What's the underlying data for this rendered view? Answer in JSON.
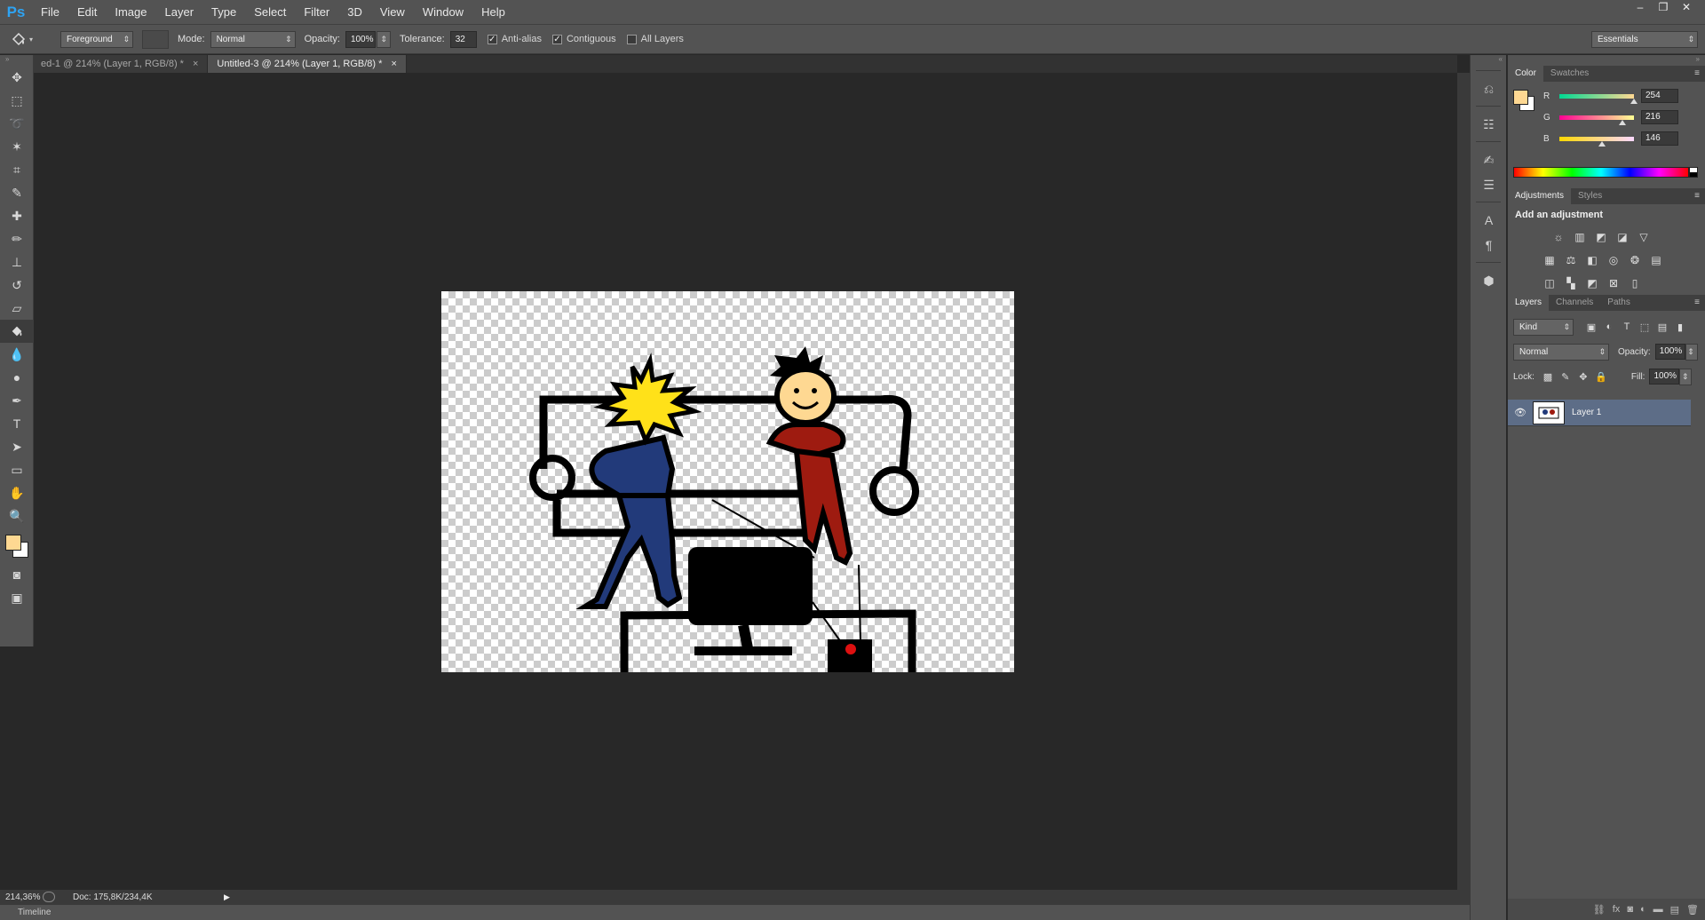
{
  "app": {
    "logo": "Ps"
  },
  "menu": [
    "File",
    "Edit",
    "Image",
    "Layer",
    "Type",
    "Select",
    "Filter",
    "3D",
    "View",
    "Window",
    "Help"
  ],
  "window_controls": {
    "minimize": "–",
    "restore": "❐",
    "close": "✕"
  },
  "options": {
    "tool_icon": "paint-bucket-icon",
    "fill_source": "Foreground",
    "mode_label": "Mode:",
    "mode_value": "Normal",
    "opacity_label": "Opacity:",
    "opacity_value": "100%",
    "tolerance_label": "Tolerance:",
    "tolerance_value": "32",
    "anti_alias": {
      "label": "Anti-alias",
      "checked": true
    },
    "contiguous": {
      "label": "Contiguous",
      "checked": true
    },
    "all_layers": {
      "label": "All Layers",
      "checked": false
    },
    "workspace": "Essentials"
  },
  "tabs": [
    {
      "label": "ed-1 @ 214% (Layer 1, RGB/8) *",
      "active": false
    },
    {
      "label": "Untitled-3 @ 214% (Layer 1, RGB/8) *",
      "active": true
    }
  ],
  "tools": [
    "move-tool",
    "marquee-tool",
    "lasso-tool",
    "magic-wand-tool",
    "crop-tool",
    "eyedropper-tool",
    "spot-healing-tool",
    "brush-tool",
    "clone-stamp-tool",
    "history-brush-tool",
    "eraser-tool",
    "paint-bucket-tool",
    "blur-tool",
    "dodge-tool",
    "pen-tool",
    "type-tool",
    "path-selection-tool",
    "rectangle-tool",
    "hand-tool",
    "zoom-tool"
  ],
  "active_tool": "paint-bucket-tool",
  "colors": {
    "foreground": "#fed892",
    "background": "#ffffff"
  },
  "status": {
    "zoom": "214,36%",
    "doc": "Doc: 175,8K/234,4K"
  },
  "timeline": {
    "label": "Timeline"
  },
  "color_panel": {
    "tabs": [
      "Color",
      "Swatches"
    ],
    "r_label": "R",
    "r_value": "254",
    "g_label": "G",
    "g_value": "216",
    "b_label": "B",
    "b_value": "146"
  },
  "adjustments_panel": {
    "tabs": [
      "Adjustments",
      "Styles"
    ],
    "title": "Add an adjustment"
  },
  "layers_panel": {
    "tabs": [
      "Layers",
      "Channels",
      "Paths"
    ],
    "filter": "Kind",
    "blend_mode": "Normal",
    "opacity_label": "Opacity:",
    "opacity_value": "100%",
    "lock_label": "Lock:",
    "fill_label": "Fill:",
    "fill_value": "100%",
    "layers": [
      {
        "name": "Layer 1",
        "visible": true,
        "selected": true
      }
    ]
  }
}
